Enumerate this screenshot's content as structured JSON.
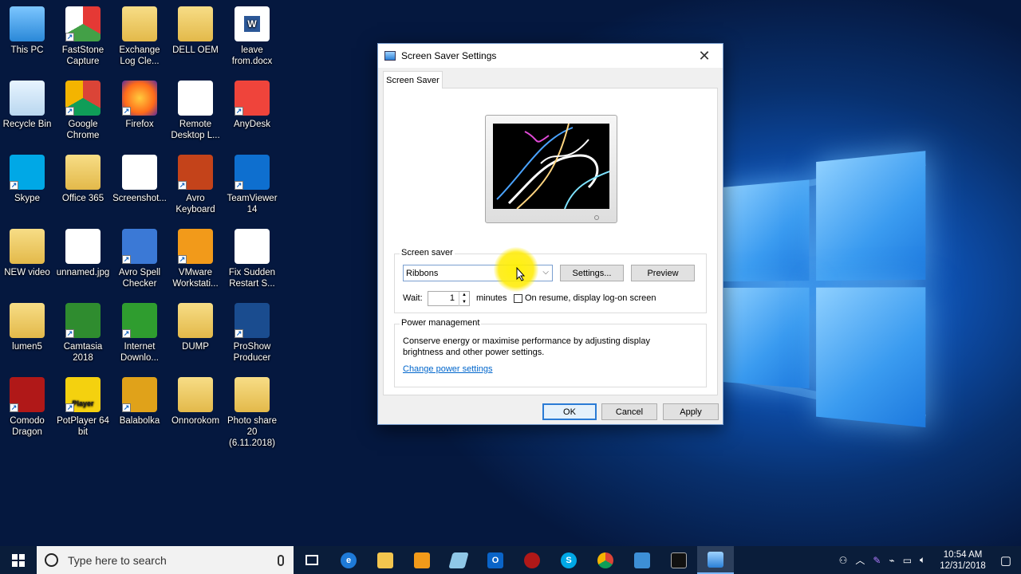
{
  "desktop": {
    "icons": [
      {
        "label": "This PC",
        "icon": "this-pc-icon"
      },
      {
        "label": "FastStone Capture",
        "icon": "faststone-icon"
      },
      {
        "label": "Exchange Log Cle...",
        "icon": "zip-folder-icon"
      },
      {
        "label": "DELL OEM",
        "icon": "folder-icon"
      },
      {
        "label": "leave from.docx",
        "icon": "word-doc-icon"
      },
      {
        "label": "Recycle Bin",
        "icon": "recycle-bin-icon"
      },
      {
        "label": "Google Chrome",
        "icon": "chrome-icon"
      },
      {
        "label": "Firefox",
        "icon": "firefox-icon"
      },
      {
        "label": "Remote Desktop L...",
        "icon": "image-file-icon"
      },
      {
        "label": "AnyDesk",
        "icon": "anydesk-icon"
      },
      {
        "label": "Skype",
        "icon": "skype-icon"
      },
      {
        "label": "Office 365",
        "icon": "folder-icon"
      },
      {
        "label": "Screenshot...",
        "icon": "image-file-icon"
      },
      {
        "label": "Avro Keyboard",
        "icon": "avro-keyboard-icon"
      },
      {
        "label": "TeamViewer 14",
        "icon": "teamviewer-icon"
      },
      {
        "label": "NEW video",
        "icon": "folder-icon"
      },
      {
        "label": "unnamed.jpg",
        "icon": "image-file-icon"
      },
      {
        "label": "Avro Spell Checker",
        "icon": "avro-spell-icon"
      },
      {
        "label": "VMware Workstati...",
        "icon": "vmware-icon"
      },
      {
        "label": "Fix Sudden Restart S...",
        "icon": "camtasia-file-icon"
      },
      {
        "label": "lumen5",
        "icon": "folder-icon"
      },
      {
        "label": "Camtasia 2018",
        "icon": "camtasia-icon"
      },
      {
        "label": "Internet Downlo...",
        "icon": "idm-icon"
      },
      {
        "label": "DUMP",
        "icon": "folder-icon"
      },
      {
        "label": "ProShow Producer",
        "icon": "proshow-icon"
      },
      {
        "label": "Comodo Dragon",
        "icon": "comodo-icon"
      },
      {
        "label": "PotPlayer 64 bit",
        "icon": "potplayer-icon"
      },
      {
        "label": "Balabolka",
        "icon": "balabolka-icon"
      },
      {
        "label": "Onnorokom",
        "icon": "folder-icon"
      },
      {
        "label": "Photo share 20 (6.11.2018)",
        "icon": "folder-icon"
      }
    ],
    "potplayer_badge": "Player"
  },
  "dialog": {
    "title": "Screen Saver Settings",
    "tab": "Screen Saver",
    "screen_saver_group": "Screen saver",
    "selected_saver": "Ribbons",
    "settings_button": "Settings...",
    "preview_button": "Preview",
    "wait_label": "Wait:",
    "wait_value": "1",
    "minutes_label": "minutes",
    "resume_checkbox_label": "On resume, display log-on screen",
    "resume_checked": false,
    "power_group": "Power management",
    "power_text": "Conserve energy or maximise performance by adjusting display brightness and other power settings.",
    "power_link": "Change power settings",
    "ok_button": "OK",
    "cancel_button": "Cancel",
    "apply_button": "Apply"
  },
  "taskbar": {
    "search_placeholder": "Type here to search",
    "clock_time": "10:54 AM",
    "clock_date": "12/31/2018"
  }
}
